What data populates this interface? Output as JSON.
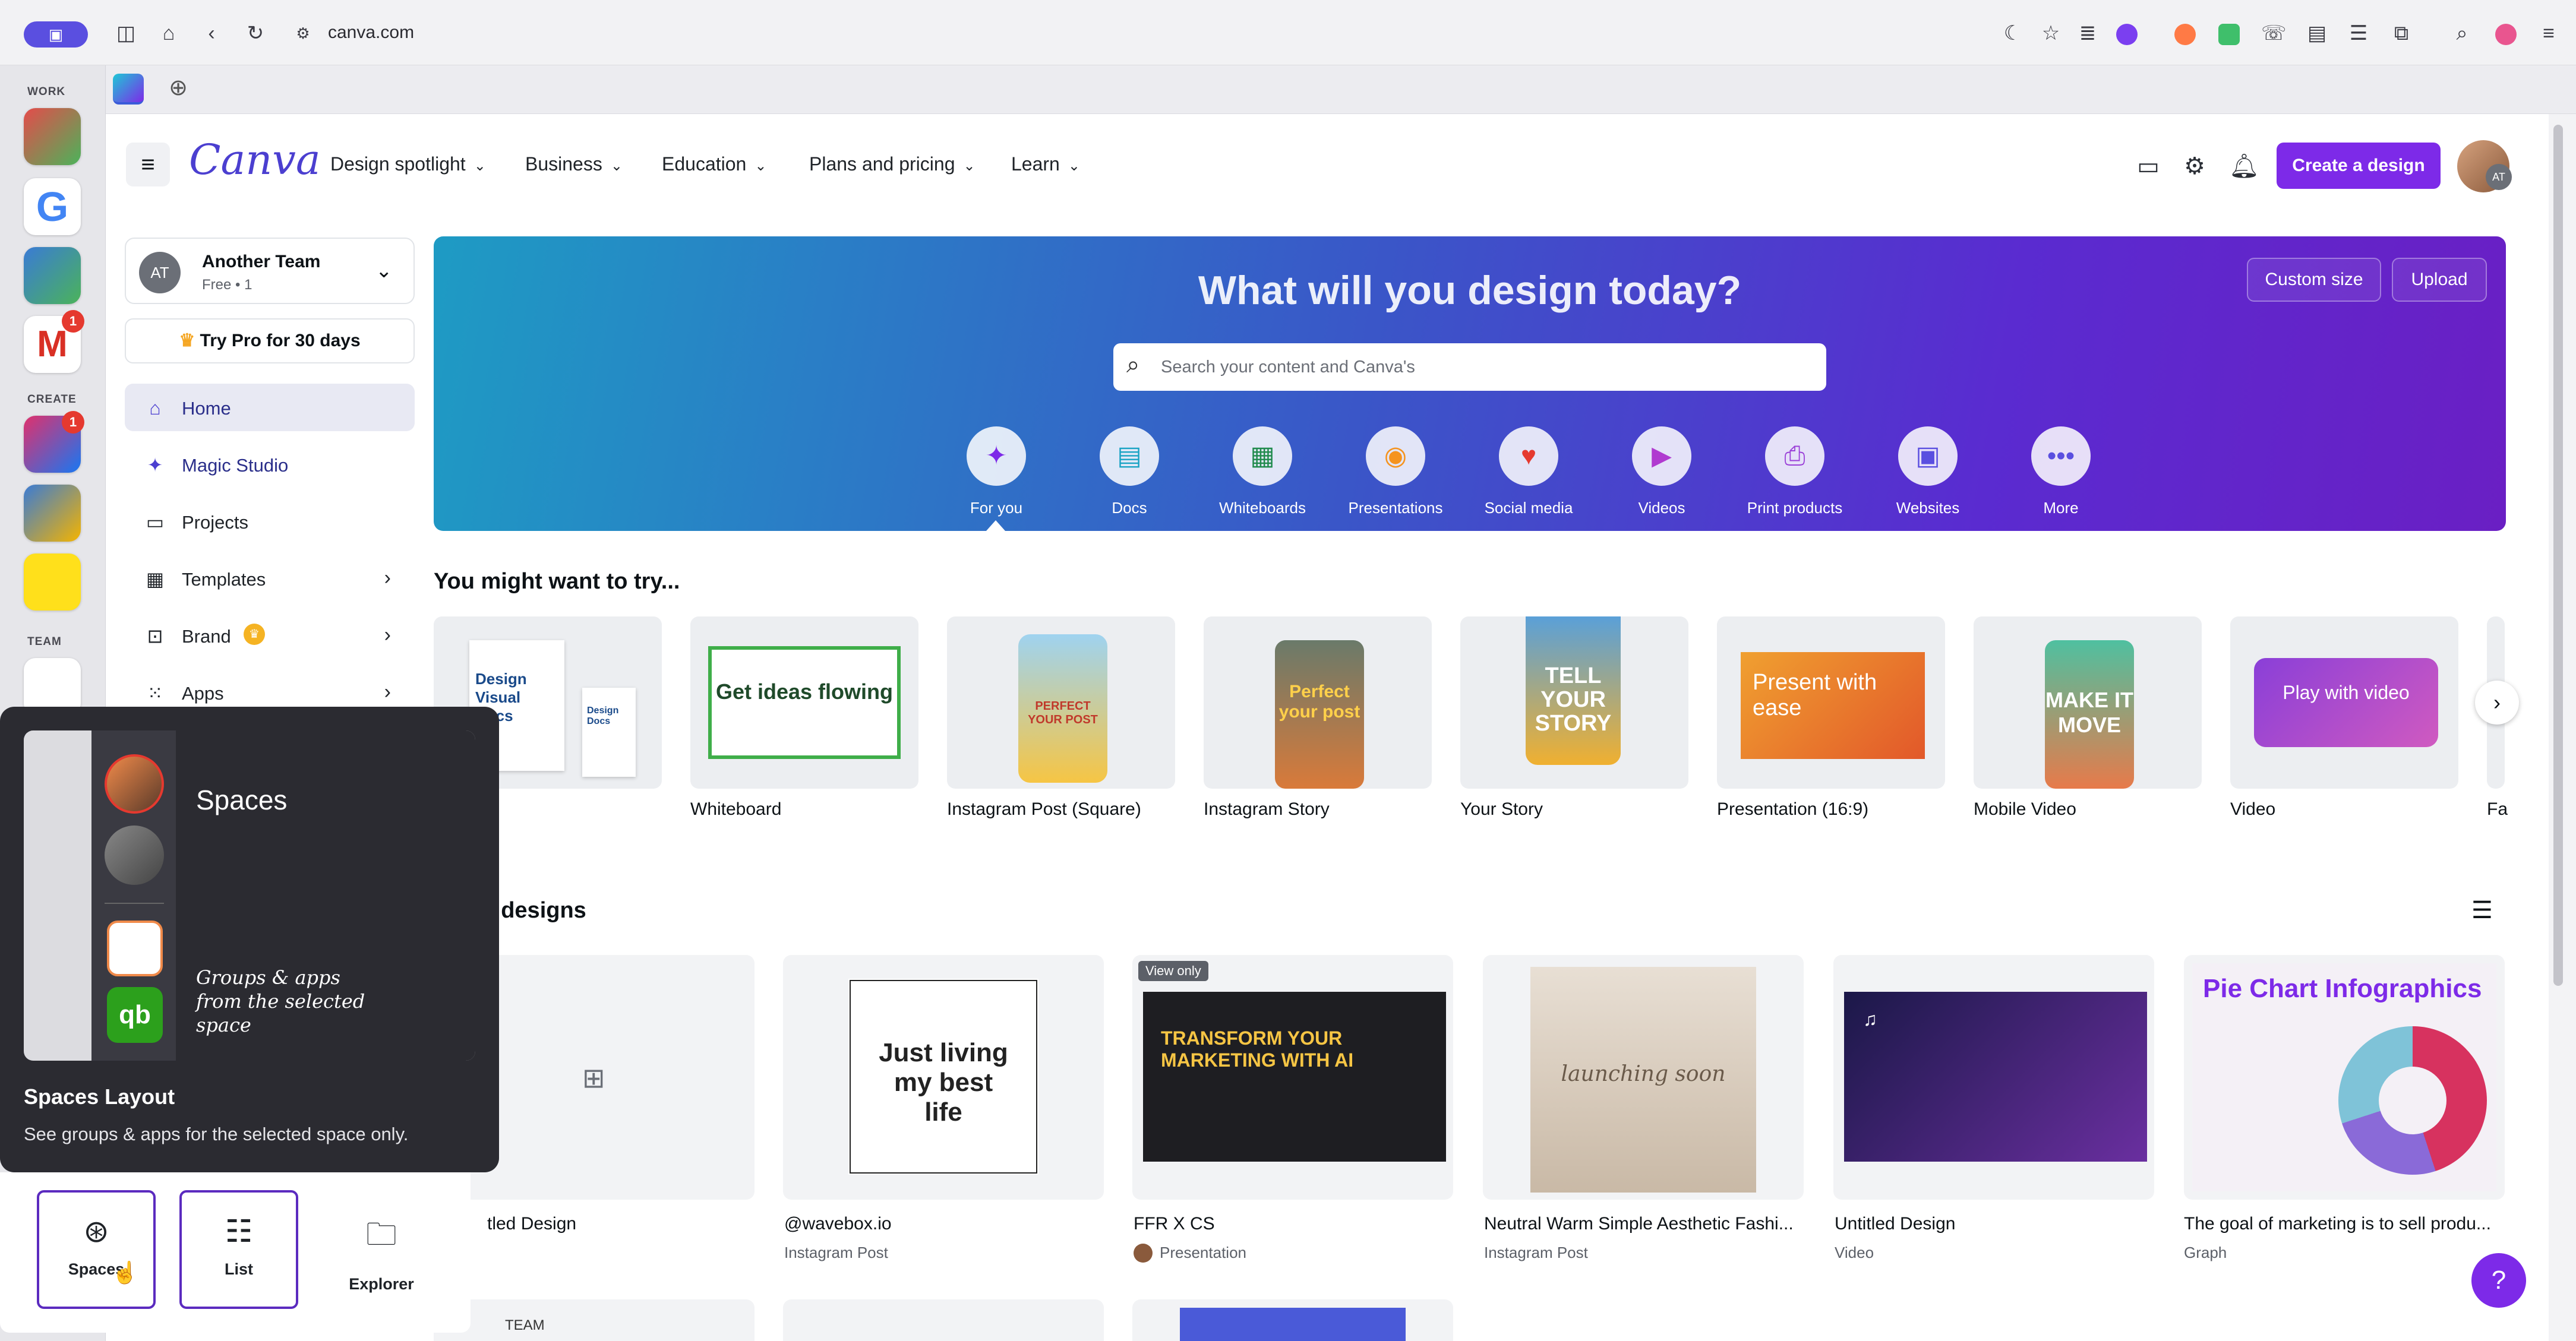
{
  "browser": {
    "url": "canva.com"
  },
  "rail": {
    "sections": [
      "WORK",
      "CREATE",
      "TEAM"
    ],
    "badges": [
      "1",
      "1"
    ]
  },
  "header": {
    "logo": "Canva",
    "nav": [
      "Design spotlight",
      "Business",
      "Education",
      "Plans and pricing",
      "Learn"
    ],
    "create_button": "Create a design",
    "avatar_initials": "AT"
  },
  "sidebar": {
    "team_initials": "AT",
    "team_name": "Another Team",
    "team_meta": "Free • 1",
    "try_pro": "Try Pro for 30 days",
    "items": [
      {
        "label": "Home"
      },
      {
        "label": "Magic Studio"
      },
      {
        "label": "Projects"
      },
      {
        "label": "Templates"
      },
      {
        "label": "Brand"
      },
      {
        "label": "Apps"
      }
    ]
  },
  "hero": {
    "title": "What will you design today?",
    "search_placeholder": "Search your content and Canva's",
    "custom_size": "Custom size",
    "upload": "Upload",
    "categories": [
      "For you",
      "Docs",
      "Whiteboards",
      "Presentations",
      "Social media",
      "Videos",
      "Print products",
      "Websites",
      "More"
    ]
  },
  "try_section": {
    "title": "You might want to try...",
    "items": [
      "Whiteboard",
      "Instagram Post (Square)",
      "Instagram Story",
      "Your Story",
      "Presentation (16:9)",
      "Mobile Video",
      "Video",
      "Fa"
    ],
    "card_texts": {
      "docs_a": "Design Visual Docs",
      "docs_b": "Design Docs",
      "whiteboard": "Get ideas flowing",
      "post": "PERFECT YOUR POST",
      "story": "Perfect your post",
      "your_story": "TELL YOUR STORY",
      "presentation": "Present with ease",
      "mobile": "MAKE IT MOVE",
      "video": "Play with video"
    }
  },
  "recent": {
    "title_fragment": "t designs",
    "designs": [
      {
        "title": "tled Design",
        "sub": ""
      },
      {
        "title": "@wavebox.io",
        "sub": "Instagram Post",
        "art": "Just living my best life"
      },
      {
        "title": "FFR X CS",
        "sub": "Presentation",
        "badge": "View only",
        "art": "TRANSFORM YOUR MARKETING WITH AI"
      },
      {
        "title": "Neutral Warm Simple Aesthetic Fashi...",
        "sub": "Instagram Post",
        "art": "launching soon"
      },
      {
        "title": "Untitled Design",
        "sub": "Video"
      },
      {
        "title": "The goal of marketing is to sell produ...",
        "sub": "Graph",
        "art": "Pie Chart Infographics"
      }
    ],
    "partial_card": "TEAM"
  },
  "popup": {
    "preview_title": "Spaces",
    "preview_caption": "Groups & apps from the selected space",
    "heading_bold": "Spaces",
    "heading_rest": " Layout",
    "description": "See groups & apps for the selected space only.",
    "options": [
      {
        "label": "Spaces",
        "icon": "spaces-icon",
        "selected": true
      },
      {
        "label": "List",
        "icon": "list-icon",
        "selected": false
      },
      {
        "label": "Explorer",
        "icon": "folder-icon",
        "selected": false
      }
    ]
  },
  "help_label": "?",
  "colors": {
    "brand": "#7d2ae8",
    "selected_border": "#5b2bbf",
    "popup_bg": "#2b2b31"
  }
}
